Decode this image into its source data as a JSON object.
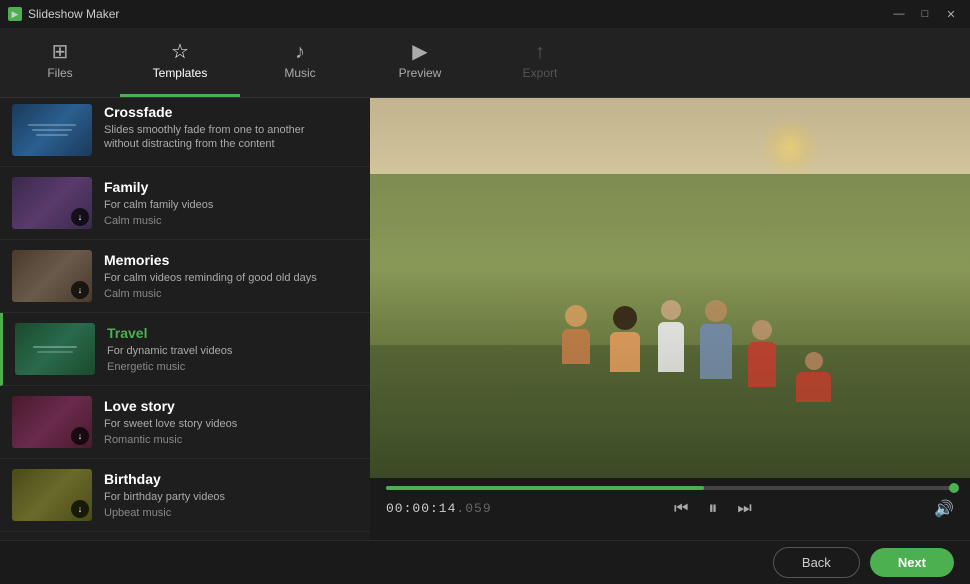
{
  "app": {
    "title": "Slideshow Maker",
    "icon": "▶"
  },
  "titlebar": {
    "minimize": "—",
    "maximize": "□",
    "close": "✕"
  },
  "nav": {
    "items": [
      {
        "id": "files",
        "label": "Files",
        "icon": "⊞",
        "active": false
      },
      {
        "id": "templates",
        "label": "Templates",
        "icon": "☆",
        "active": true
      },
      {
        "id": "music",
        "label": "Music",
        "icon": "♪",
        "active": false
      },
      {
        "id": "preview",
        "label": "Preview",
        "icon": "▶",
        "active": false
      },
      {
        "id": "export",
        "label": "Export",
        "icon": "↑",
        "active": false
      }
    ]
  },
  "templates": [
    {
      "id": "crossfade",
      "name": "Crossfade",
      "desc": "Slides smoothly fade from one to another\nwithout distracting from the content",
      "music": "",
      "thumbClass": "thumb-crossfade",
      "badge": "",
      "active": false,
      "partial": true
    },
    {
      "id": "family",
      "name": "Family",
      "desc": "For calm family videos",
      "music": "Calm music",
      "thumbClass": "thumb-family",
      "badge": "↓",
      "active": false,
      "partial": false
    },
    {
      "id": "memories",
      "name": "Memories",
      "desc": "For calm videos reminding of good old days",
      "music": "Calm music",
      "thumbClass": "thumb-memories",
      "badge": "↓",
      "active": false,
      "partial": false
    },
    {
      "id": "travel",
      "name": "Travel",
      "desc": "For dynamic travel videos",
      "music": "Energetic music",
      "thumbClass": "thumb-travel",
      "badge": "",
      "active": true,
      "partial": false
    },
    {
      "id": "lovestory",
      "name": "Love story",
      "desc": "For sweet love story videos",
      "music": "Romantic music",
      "thumbClass": "thumb-lovestory",
      "badge": "↓",
      "active": false,
      "partial": false
    },
    {
      "id": "birthday",
      "name": "Birthday",
      "desc": "For birthday party videos",
      "music": "Upbeat music",
      "thumbClass": "thumb-birthday",
      "badge": "↓",
      "active": false,
      "partial": false
    }
  ],
  "player": {
    "time_current": "00:00:14",
    "time_dim": ".059",
    "progress_percent": 56,
    "volume_icon": "🔊"
  },
  "footer": {
    "back_label": "Back",
    "next_label": "Next"
  }
}
